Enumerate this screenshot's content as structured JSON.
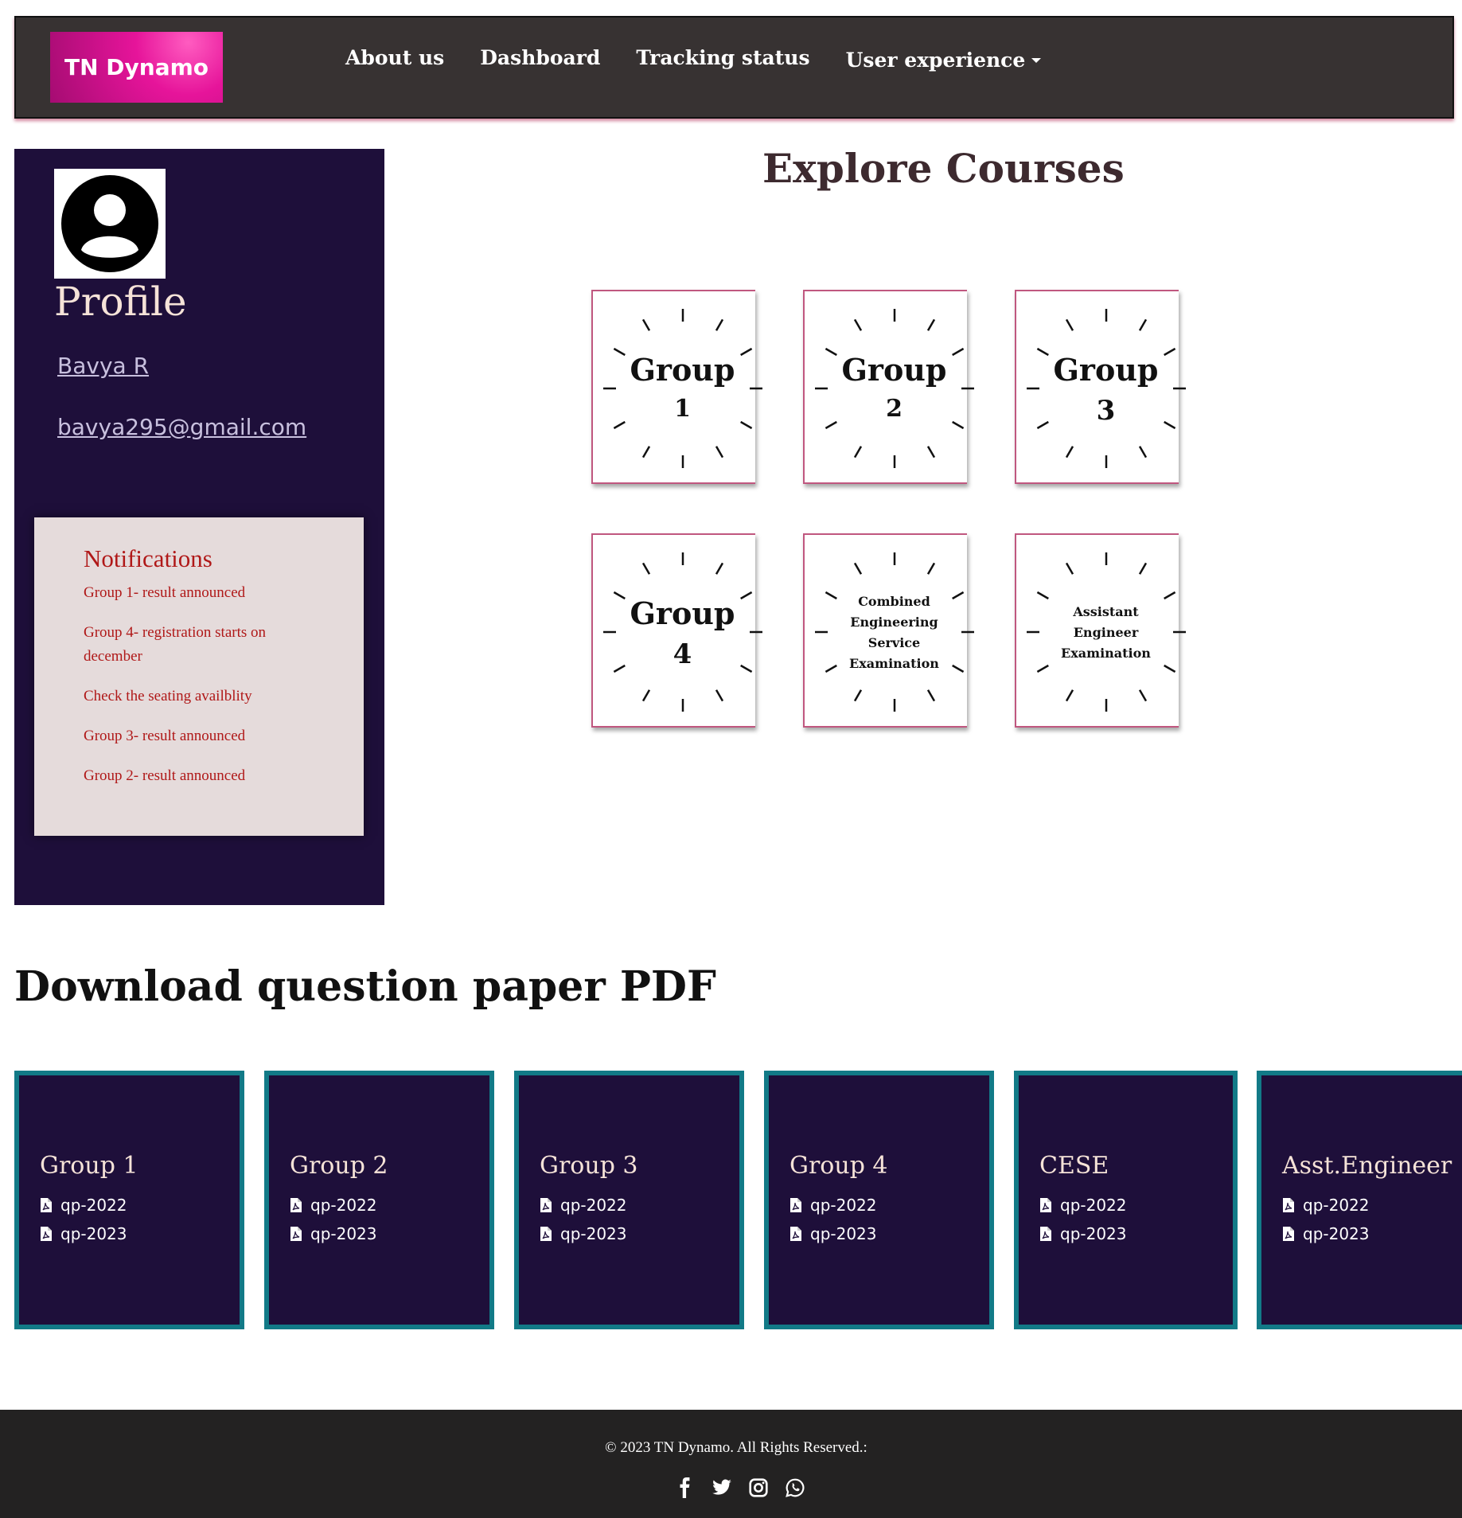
{
  "navbar": {
    "brand": "TN Dynamo",
    "links": [
      "About us",
      "Dashboard",
      "Tracking status"
    ],
    "dropdown_label": "User experience"
  },
  "profile": {
    "title": "Profile",
    "name": "Bavya R",
    "email": "bavya295@gmail.com"
  },
  "notifications": {
    "title": "Notifications",
    "items": [
      "Group 1- result announced",
      "Group 4- registration starts on december",
      "Check the seating availblity",
      "Group 3- result announced",
      "Group 2- result announced"
    ]
  },
  "explore": {
    "title": "Explore Courses",
    "courses": [
      {
        "line1": "Group",
        "line2": "1"
      },
      {
        "line1": "Group",
        "line2": "2"
      },
      {
        "line1": "Group",
        "line2": "3"
      },
      {
        "line1": "Group",
        "line2": "4"
      },
      {
        "lines": [
          "Combined",
          "Engineering",
          "Service",
          "Examination"
        ]
      },
      {
        "lines": [
          "Assistant",
          "Engineer",
          "Examination"
        ]
      }
    ]
  },
  "download": {
    "title": "Download question paper PDF",
    "cards": [
      {
        "title": "Group 1",
        "links": [
          "qp-2022",
          "qp-2023"
        ]
      },
      {
        "title": "Group 2",
        "links": [
          "qp-2022",
          "qp-2023"
        ]
      },
      {
        "title": "Group 3",
        "links": [
          "qp-2022",
          "qp-2023"
        ]
      },
      {
        "title": "Group 4",
        "links": [
          "qp-2022",
          "qp-2023"
        ]
      },
      {
        "title": "CESE",
        "links": [
          "qp-2022",
          "qp-2023"
        ]
      },
      {
        "title": "Asst.Engineer",
        "links": [
          "qp-2022",
          "qp-2023"
        ]
      }
    ]
  },
  "footer": {
    "copyright": "© 2023 TN Dynamo. All Rights Reserved.:",
    "socials": [
      "facebook-icon",
      "twitter-icon",
      "instagram-icon",
      "whatsapp-icon"
    ]
  },
  "colors": {
    "navbar_bg": "#373232",
    "brand_pink": "#e6149a",
    "sidebar_bg": "#1e0f3a",
    "notif_bg": "#e5dbdb",
    "notif_text": "#b01818",
    "card_border": "#127a87",
    "footer_bg": "#232222"
  }
}
